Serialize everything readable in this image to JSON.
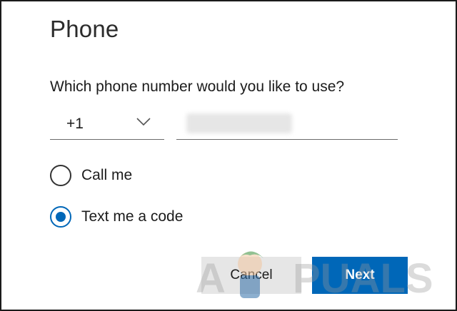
{
  "dialog": {
    "title": "Phone",
    "question": "Which phone number would you like to use?"
  },
  "country_code": {
    "value": "+1",
    "icon": "chevron-down-icon"
  },
  "phone_number": {
    "value": ""
  },
  "options": [
    {
      "label": "Call me",
      "selected": false
    },
    {
      "label": "Text me a code",
      "selected": true
    }
  ],
  "buttons": {
    "cancel": "Cancel",
    "next": "Next"
  },
  "watermark": {
    "text": "APPUALS"
  },
  "colors": {
    "accent": "#0067b8",
    "cancel_bg": "#e6e6e6"
  }
}
